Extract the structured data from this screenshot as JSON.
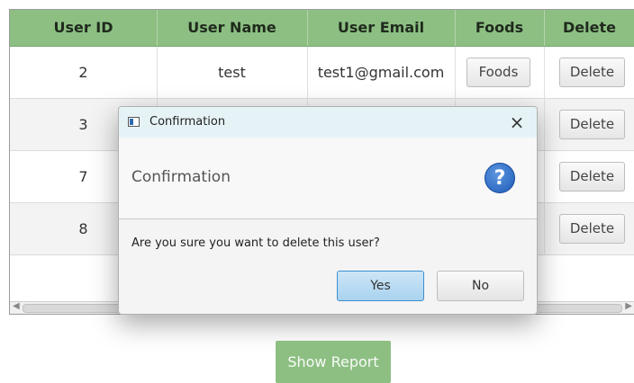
{
  "table": {
    "columns": [
      "User ID",
      "User Name",
      "User Email",
      "Foods",
      "Delete"
    ],
    "rows": [
      {
        "id": "2",
        "name": "test",
        "email": "test1@gmail.com",
        "foods_label": "Foods",
        "delete_label": "Delete"
      },
      {
        "id": "3",
        "name": "",
        "email": "",
        "foods_label": "",
        "delete_label": "Delete"
      },
      {
        "id": "7",
        "name": "",
        "email": "",
        "foods_label": "",
        "delete_label": "Delete"
      },
      {
        "id": "8",
        "name": "",
        "email": "",
        "foods_label": "",
        "delete_label": "Delete"
      }
    ]
  },
  "dialog": {
    "title": "Confirmation",
    "header_text": "Confirmation",
    "help_glyph": "?",
    "close_glyph": "×",
    "content_text": "Are you sure you want to delete this user?",
    "yes_label": "Yes",
    "no_label": "No"
  },
  "report_button_label": "Show Report",
  "colors": {
    "header_green": "#8dbf83",
    "dialog_title_bg": "#e6f3f6",
    "help_icon_blue": "#1e5bb8",
    "default_button_border": "#3d8fd0"
  },
  "icons": {
    "dialog_app": "window-icon",
    "help": "question-icon",
    "close": "close-icon"
  }
}
